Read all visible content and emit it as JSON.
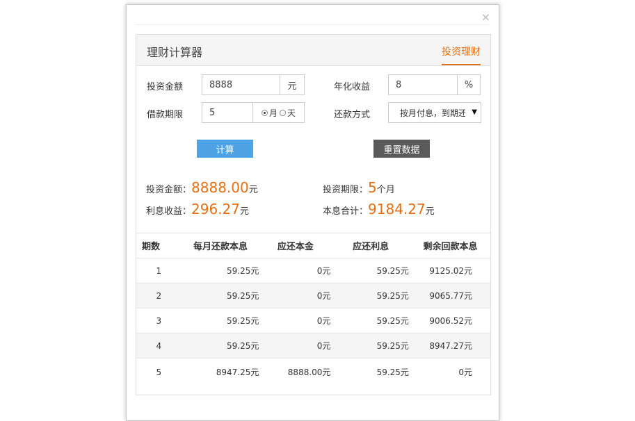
{
  "dialog": {
    "close_label": "×",
    "title": "理财计算器",
    "tab_label": "投资理财"
  },
  "form": {
    "amount_label": "投资金额",
    "amount_value": "8888",
    "amount_unit": "元",
    "rate_label": "年化收益",
    "rate_value": "8",
    "rate_unit": "%",
    "term_label": "借款期限",
    "term_value": "5",
    "term_unit_month": "月",
    "term_unit_day": "天",
    "repay_label": "还款方式",
    "repay_selected": "按月付息，到期还本"
  },
  "buttons": {
    "calculate": "计算",
    "reset": "重置数据"
  },
  "results": {
    "amount_label": "投资金额：",
    "amount_value": "8888.00",
    "amount_unit": "元",
    "term_label": "投资期限：",
    "term_value": "5",
    "term_unit": "个月",
    "interest_label": "利息收益：",
    "interest_value": "296.27",
    "interest_unit": "元",
    "total_label": "本息合计：",
    "total_value": "9184.27",
    "total_unit": "元"
  },
  "table": {
    "headers": [
      "期数",
      "每月还款本息",
      "应还本金",
      "应还利息",
      "剩余回款本息"
    ],
    "rows": [
      [
        "1",
        "59.25元",
        "0元",
        "59.25元",
        "9125.02元"
      ],
      [
        "2",
        "59.25元",
        "0元",
        "59.25元",
        "9065.77元"
      ],
      [
        "3",
        "59.25元",
        "0元",
        "59.25元",
        "9006.52元"
      ],
      [
        "4",
        "59.25元",
        "0元",
        "59.25元",
        "8947.27元"
      ],
      [
        "5",
        "8947.25元",
        "8888.00元",
        "59.25元",
        "0元"
      ]
    ]
  },
  "colors": {
    "accent": "#e56f14",
    "calc_button": "#4da3e6",
    "reset_button": "#5a5a5a"
  }
}
